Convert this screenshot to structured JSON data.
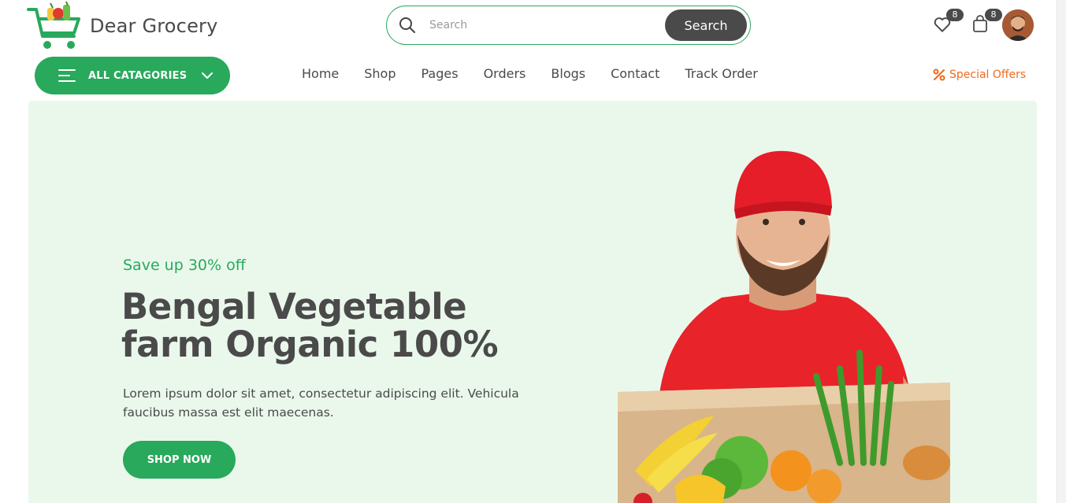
{
  "brand": {
    "name": "Dear Grocery"
  },
  "search": {
    "placeholder": "Search",
    "button_label": "Search"
  },
  "header": {
    "wishlist": {
      "icon": "heart-icon",
      "count": "8"
    },
    "cart": {
      "icon": "shopping-bag-icon",
      "count": "8"
    },
    "avatar": {
      "icon": "user-avatar"
    }
  },
  "categories": {
    "label": "ALL CATAGORIES"
  },
  "nav": {
    "items": [
      {
        "label": "Home"
      },
      {
        "label": "Shop"
      },
      {
        "label": "Pages"
      },
      {
        "label": "Orders"
      },
      {
        "label": "Blogs"
      },
      {
        "label": "Contact"
      },
      {
        "label": "Track Order"
      }
    ],
    "special_offers": "Special Offers"
  },
  "hero": {
    "kicker": "Save up 30% off",
    "title_line1": "Bengal Vegetable",
    "title_line2": "farm Organic 100%",
    "description": "Lorem ipsum dolor sit amet, consectetur adipiscing elit. Vehicula faucibus massa est elit maecenas.",
    "cta_label": "SHOP NOW"
  },
  "colors": {
    "brand_green": "#28a95b",
    "hero_bg": "#eaf8ec",
    "dark": "#4a4a4a",
    "offer_orange": "#f06a1e"
  }
}
